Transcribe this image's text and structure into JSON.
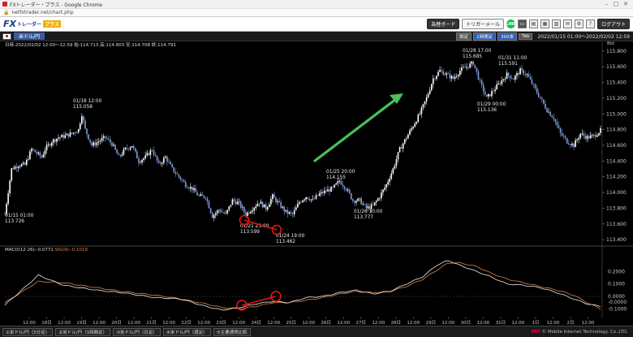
{
  "browser": {
    "title": "FXトレーダー・プラス - Google Chrome",
    "url": "netfxtrader.net/chart.php"
  },
  "app": {
    "logo_main": "FX",
    "logo_sub": "トレーダー",
    "logo_plus": "プラス",
    "buttons": {
      "board": "為替ボード",
      "trigger_mail": "トリガーメール",
      "logout": "ログアウト"
    },
    "line_label": "LINE"
  },
  "chart_header": {
    "pair": "米ドル/円",
    "settings": "設定",
    "timeframe": "1時間足",
    "bars": "300本",
    "tab": "Tab",
    "range": "2022/01/15 01:00～2022/02/02 12:59",
    "info": "日時:2022/02/02 12:00～12:59 始:114.713 高:114.803 安:114.708 終:114.791",
    "bid": "Bid"
  },
  "macd_header": {
    "macd": "MACD(12-26):-0.0771",
    "sig": "SIG(9):-0.1019"
  },
  "chart_data": {
    "type": "candlestick",
    "timeframe": "1時間足",
    "price_axis": {
      "range": [
        113.35,
        115.85
      ],
      "ticks": [
        "115.800",
        "115.600",
        "115.400",
        "115.200",
        "115.000",
        "114.800",
        "114.600",
        "114.400",
        "114.200",
        "114.000",
        "113.800",
        "113.600",
        "113.400"
      ]
    },
    "macd_axis": {
      "range": [
        -0.15,
        0.32
      ],
      "ticks": [
        "0.2000",
        "0.1000",
        "0.0000",
        "-0.0000",
        "-0.1000"
      ]
    },
    "x_ticks": [
      "12:00",
      "18日",
      "12:00",
      "19日",
      "12:00",
      "20日",
      "12:00",
      "21日",
      "12:00",
      "22日",
      "12:00",
      "23日",
      "12:00",
      "24日",
      "12:00",
      "25日",
      "12:00",
      "26日",
      "12:00",
      "27日",
      "12:00",
      "28日",
      "12:00",
      "29日",
      "12:00",
      "30日",
      "12:00",
      "31日",
      "12:00",
      "1日",
      "12:00",
      "2日",
      "12:00"
    ],
    "annotations": [
      {
        "date": "01/15 01:00",
        "value": "113.726"
      },
      {
        "date": "01/18 12:00",
        "value": "115.058"
      },
      {
        "date": "01/21 23:00",
        "value": "113.599"
      },
      {
        "date": "01/24 19:00",
        "value": "113.462"
      },
      {
        "date": "01/25 20:00",
        "value": "114.155"
      },
      {
        "date": "01/26 10:00",
        "value": "113.777"
      },
      {
        "date": "01/28 17:00",
        "value": "115.685"
      },
      {
        "date": "01/29 00:00",
        "value": "115.136"
      },
      {
        "date": "01/31 11:00",
        "value": "115.591"
      }
    ],
    "price_keypoints": [
      [
        0,
        113.73
      ],
      [
        4,
        114.3
      ],
      [
        8,
        114.35
      ],
      [
        12,
        114.35
      ],
      [
        16,
        114.55
      ],
      [
        22,
        114.45
      ],
      [
        24,
        114.55
      ],
      [
        28,
        114.65
      ],
      [
        32,
        114.7
      ],
      [
        36,
        114.72
      ],
      [
        40,
        114.75
      ],
      [
        44,
        114.8
      ],
      [
        46,
        115.0
      ],
      [
        48,
        114.8
      ],
      [
        52,
        114.6
      ],
      [
        56,
        114.65
      ],
      [
        60,
        114.7
      ],
      [
        64,
        114.62
      ],
      [
        68,
        114.45
      ],
      [
        72,
        114.55
      ],
      [
        76,
        114.6
      ],
      [
        80,
        114.4
      ],
      [
        84,
        114.45
      ],
      [
        88,
        114.55
      ],
      [
        92,
        114.35
      ],
      [
        96,
        114.45
      ],
      [
        100,
        114.3
      ],
      [
        104,
        114.2
      ],
      [
        108,
        114.1
      ],
      [
        112,
        114.05
      ],
      [
        116,
        113.95
      ],
      [
        120,
        113.95
      ],
      [
        124,
        113.7
      ],
      [
        128,
        113.78
      ],
      [
        132,
        113.72
      ],
      [
        136,
        113.9
      ],
      [
        140,
        113.86
      ],
      [
        144,
        113.72
      ],
      [
        148,
        113.8
      ],
      [
        152,
        113.88
      ],
      [
        156,
        113.8
      ],
      [
        160,
        113.95
      ],
      [
        164,
        113.85
      ],
      [
        168,
        113.75
      ],
      [
        172,
        113.72
      ],
      [
        176,
        113.88
      ],
      [
        180,
        113.95
      ],
      [
        184,
        113.9
      ],
      [
        188,
        113.98
      ],
      [
        192,
        114.02
      ],
      [
        196,
        114.05
      ],
      [
        200,
        114.15
      ],
      [
        204,
        114.05
      ],
      [
        208,
        113.9
      ],
      [
        212,
        113.9
      ],
      [
        216,
        113.8
      ],
      [
        220,
        113.83
      ],
      [
        224,
        113.95
      ],
      [
        228,
        114.1
      ],
      [
        232,
        114.3
      ],
      [
        236,
        114.55
      ],
      [
        240,
        114.7
      ],
      [
        244,
        114.85
      ],
      [
        248,
        115.0
      ],
      [
        252,
        115.2
      ],
      [
        256,
        115.45
      ],
      [
        260,
        115.55
      ],
      [
        264,
        115.5
      ],
      [
        268,
        115.45
      ],
      [
        272,
        115.55
      ],
      [
        276,
        115.6
      ],
      [
        280,
        115.65
      ],
      [
        284,
        115.4
      ],
      [
        288,
        115.2
      ],
      [
        292,
        115.3
      ],
      [
        296,
        115.4
      ],
      [
        300,
        115.5
      ],
      [
        304,
        115.45
      ],
      [
        308,
        115.55
      ],
      [
        312,
        115.5
      ],
      [
        316,
        115.35
      ],
      [
        320,
        115.2
      ],
      [
        324,
        115.05
      ],
      [
        328,
        114.95
      ],
      [
        332,
        114.75
      ],
      [
        336,
        114.65
      ],
      [
        340,
        114.6
      ],
      [
        344,
        114.75
      ],
      [
        348,
        114.7
      ],
      [
        352,
        114.72
      ],
      [
        356,
        114.79
      ]
    ],
    "macd_keypoints": [
      [
        0,
        -0.07
      ],
      [
        20,
        0.17
      ],
      [
        35,
        0.09
      ],
      [
        55,
        0.05
      ],
      [
        70,
        0.03
      ],
      [
        90,
        -0.01
      ],
      [
        105,
        -0.02
      ],
      [
        120,
        -0.08
      ],
      [
        130,
        -0.11
      ],
      [
        140,
        -0.09
      ],
      [
        150,
        -0.06
      ],
      [
        160,
        -0.04
      ],
      [
        170,
        -0.05
      ],
      [
        180,
        -0.01
      ],
      [
        190,
        0.0
      ],
      [
        200,
        0.03
      ],
      [
        210,
        0.05
      ],
      [
        220,
        0.02
      ],
      [
        230,
        0.04
      ],
      [
        240,
        0.1
      ],
      [
        250,
        0.16
      ],
      [
        258,
        0.25
      ],
      [
        265,
        0.29
      ],
      [
        272,
        0.25
      ],
      [
        282,
        0.2
      ],
      [
        290,
        0.16
      ],
      [
        300,
        0.1
      ],
      [
        310,
        0.09
      ],
      [
        320,
        0.07
      ],
      [
        330,
        0.03
      ],
      [
        340,
        -0.02
      ],
      [
        348,
        -0.06
      ],
      [
        356,
        -0.08
      ]
    ],
    "sig_keypoints": [
      [
        0,
        -0.05
      ],
      [
        20,
        0.12
      ],
      [
        35,
        0.11
      ],
      [
        55,
        0.07
      ],
      [
        70,
        0.04
      ],
      [
        90,
        0.01
      ],
      [
        105,
        -0.02
      ],
      [
        120,
        -0.06
      ],
      [
        130,
        -0.09
      ],
      [
        140,
        -0.1
      ],
      [
        150,
        -0.08
      ],
      [
        160,
        -0.05
      ],
      [
        170,
        -0.05
      ],
      [
        180,
        -0.03
      ],
      [
        190,
        -0.01
      ],
      [
        200,
        0.02
      ],
      [
        210,
        0.04
      ],
      [
        220,
        0.03
      ],
      [
        230,
        0.04
      ],
      [
        240,
        0.08
      ],
      [
        250,
        0.14
      ],
      [
        258,
        0.21
      ],
      [
        265,
        0.27
      ],
      [
        272,
        0.27
      ],
      [
        282,
        0.24
      ],
      [
        290,
        0.19
      ],
      [
        300,
        0.14
      ],
      [
        310,
        0.11
      ],
      [
        320,
        0.08
      ],
      [
        330,
        0.05
      ],
      [
        340,
        0.01
      ],
      [
        348,
        -0.05
      ],
      [
        356,
        -0.1
      ]
    ],
    "colors": {
      "up": "#ffffff",
      "down": "#7e9ddb",
      "macd": "#e8e8e8",
      "sig": "#d8844a",
      "arrow": "#49c15a",
      "marker": "#e11515"
    }
  },
  "bottom_tabs": [
    "①米ドル/円（5分足）",
    "②米ドル/円（1時間足）",
    "③米ドル/円（日足）",
    "④米ドル/円（週足）",
    "⑤主要通貨比較"
  ],
  "copyright": {
    "brand": "MIT",
    "text": "© Mobile Internet Technology. Co.,LTD."
  }
}
